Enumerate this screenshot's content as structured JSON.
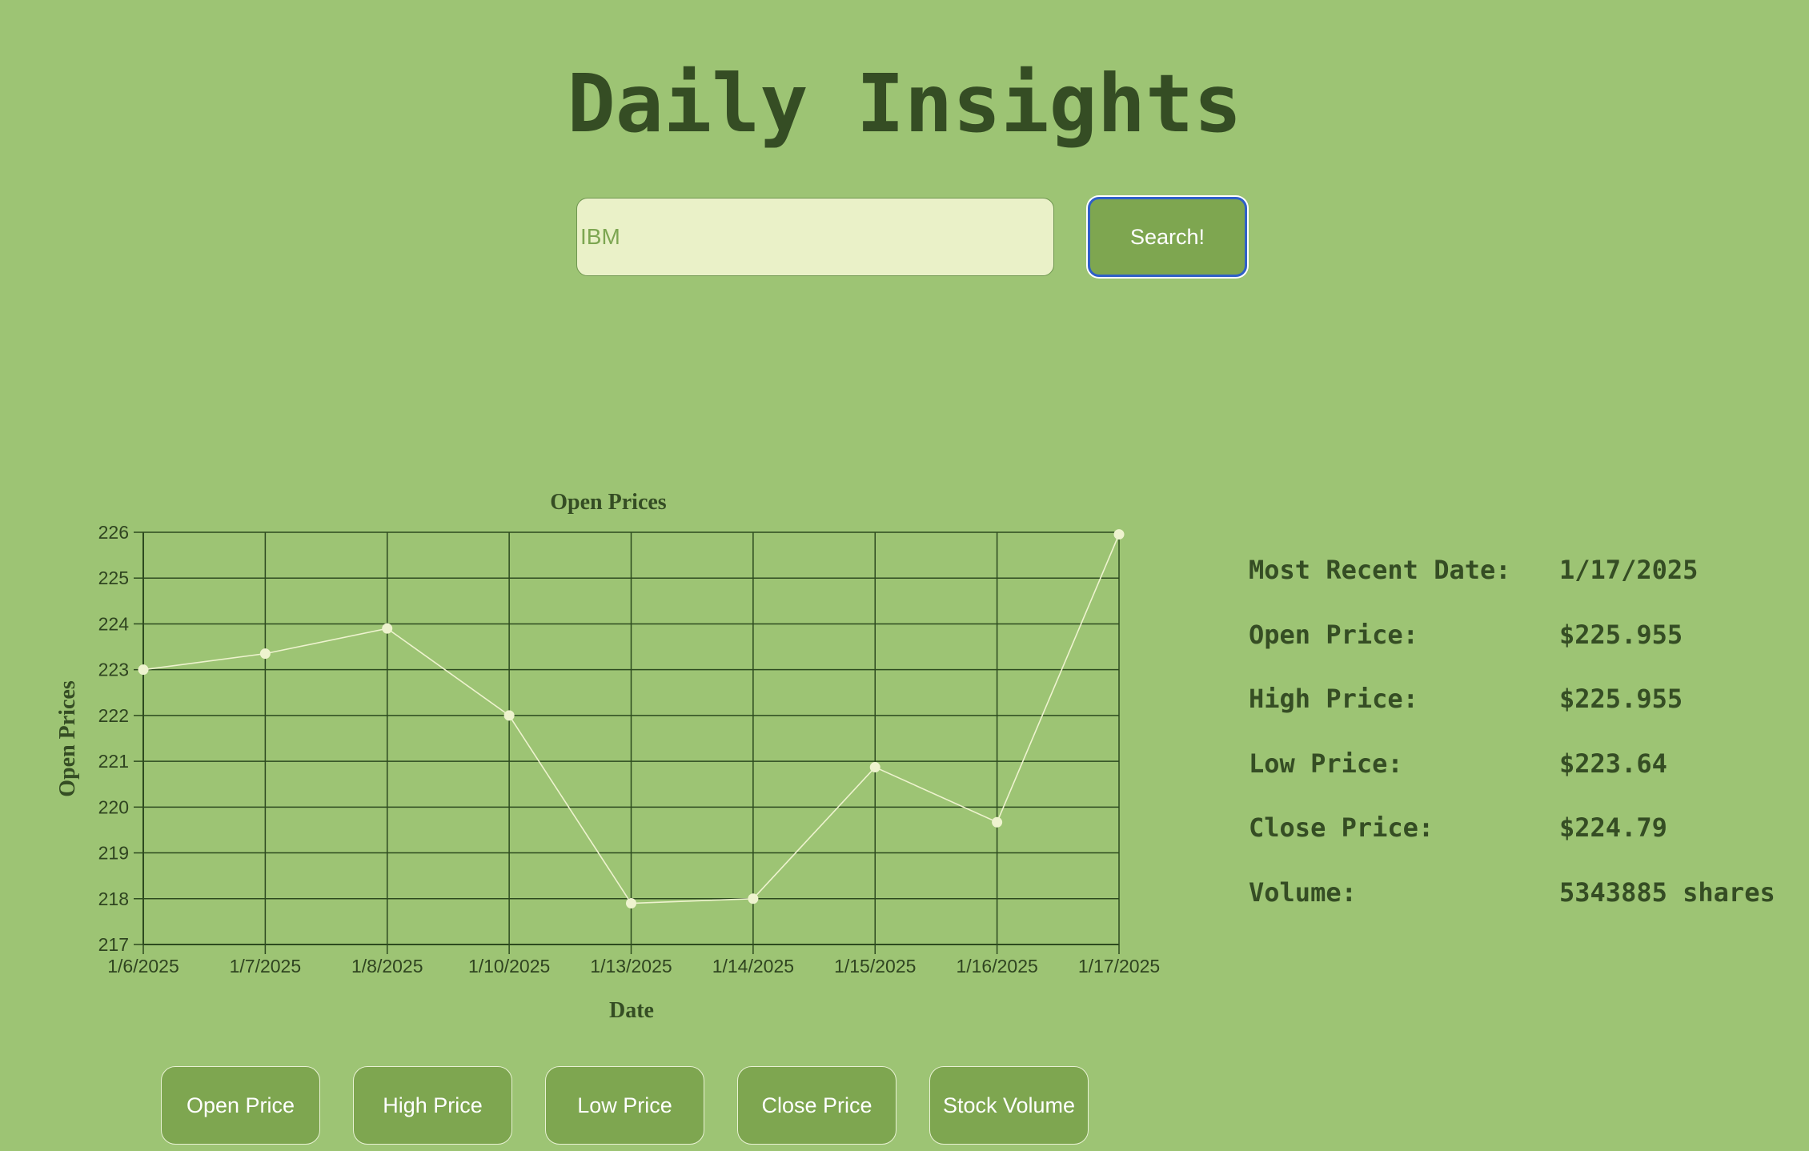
{
  "header": {
    "title": "Daily Insights"
  },
  "search": {
    "value": "",
    "placeholder": "IBM",
    "button_label": "Search!"
  },
  "chart_data": {
    "type": "line",
    "title": "Open Prices",
    "xlabel": "Date",
    "ylabel": "Open Prices",
    "categories": [
      "1/6/2025",
      "1/7/2025",
      "1/8/2025",
      "1/10/2025",
      "1/13/2025",
      "1/14/2025",
      "1/15/2025",
      "1/16/2025",
      "1/17/2025"
    ],
    "series": [
      {
        "values": [
          223.0,
          223.35,
          223.9,
          222.0,
          217.9,
          218.0,
          220.87,
          219.67,
          225.955
        ]
      }
    ],
    "ylim": [
      217,
      226
    ],
    "yticks": [
      217,
      218,
      219,
      220,
      221,
      222,
      223,
      224,
      225,
      226
    ],
    "grid": true,
    "legend": "none",
    "colors": {
      "line": "#eef3cf",
      "marker": "#eef3cf",
      "grid": "#2d4a1f",
      "text": "#354d24"
    }
  },
  "stats": [
    {
      "label": "Most Recent Date:",
      "value": "1/17/2025"
    },
    {
      "label": "Open Price:",
      "value": "$225.955"
    },
    {
      "label": "High Price:",
      "value": "$225.955"
    },
    {
      "label": "Low Price:",
      "value": "$223.64"
    },
    {
      "label": "Close Price:",
      "value": "$224.79"
    },
    {
      "label": "Volume:",
      "value": "5343885 shares"
    }
  ],
  "metric_buttons": [
    {
      "label": "Open Price"
    },
    {
      "label": "High Price"
    },
    {
      "label": "Low Price"
    },
    {
      "label": "Close Price"
    },
    {
      "label": "Stock Volume"
    }
  ],
  "colors": {
    "background": "#9dc474",
    "heading": "#354d24",
    "button": "#7ea650",
    "input_bg": "#eaf1c8",
    "focus_ring": "#2f5fc8"
  }
}
